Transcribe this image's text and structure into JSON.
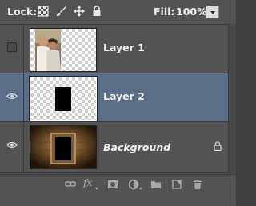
{
  "lockbar": {
    "lock_label": "Lock:",
    "fill_label": "Fill:",
    "fill_value": "100%",
    "icons": [
      "lock-transparent-pixels-icon",
      "lock-image-pixels-icon",
      "lock-position-icon",
      "lock-all-icon",
      "fill-dropdown-icon"
    ]
  },
  "layers": [
    {
      "name": "Layer 1",
      "visible": false,
      "selected": false,
      "thumb": "photo-couple"
    },
    {
      "name": "Layer 2",
      "visible": true,
      "selected": true,
      "thumb": "black-rectangle"
    },
    {
      "name": "Background",
      "visible": true,
      "selected": false,
      "locked": true,
      "thumb": "stone-frame"
    }
  ],
  "bottombar": {
    "icons": [
      "link-layers-icon",
      "layer-style-icon",
      "layer-mask-icon",
      "adjustment-layer-icon",
      "new-group-icon",
      "new-layer-icon",
      "delete-layer-icon"
    ],
    "fx_label": "fx"
  },
  "colors": {
    "panel": "#535353",
    "selected_row": "#5b6e85"
  }
}
